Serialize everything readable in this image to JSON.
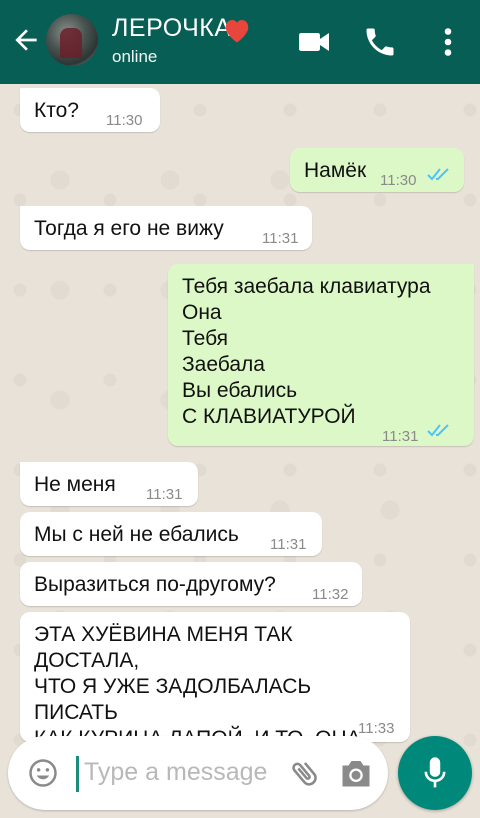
{
  "header": {
    "contact_name": "ЛЕРОЧКА",
    "status": "online",
    "accent_color": "#075e54",
    "icons": [
      "back-arrow-icon",
      "heart-icon",
      "video-call-icon",
      "phone-icon",
      "more-vert-icon"
    ]
  },
  "messages": [
    {
      "direction": "in",
      "text": "Кто?",
      "time": "11:30"
    },
    {
      "direction": "out",
      "text": "Намёк",
      "time": "11:30",
      "read": true
    },
    {
      "direction": "in",
      "text": "Тогда я его не вижу",
      "time": "11:31"
    },
    {
      "direction": "out",
      "text": "Тебя заебала клавиатура\nОна\nТебя\nЗаебала\nВы ебались\nС КЛАВИАТУРОЙ",
      "time": "11:31",
      "read": true
    },
    {
      "direction": "in",
      "text": "Не меня",
      "time": "11:31"
    },
    {
      "direction": "in",
      "text": "Мы с ней не ебались",
      "time": "11:31"
    },
    {
      "direction": "in",
      "text": "Выразиться по-другому?",
      "time": "11:32"
    },
    {
      "direction": "in",
      "text": "ЭТА ХУЁВИНА МЕНЯ ТАК ДОСТАЛА,\nЧТО Я УЖЕ ЗАДОЛБАЛАСЬ ПИСАТЬ\nКАК КУРИЦА ЛАПОЙ, И ТО, ОНА\nЛУЧШЕ МЕНЯ ПИШЕТ",
      "time": "11:33"
    }
  ],
  "composer": {
    "placeholder": "Type a message",
    "icons": [
      "emoji-icon",
      "attach-icon",
      "camera-icon",
      "mic-icon"
    ],
    "mic_color": "#00897b"
  },
  "colors": {
    "incoming_bubble": "#ffffff",
    "outgoing_bubble": "#dcf8c6",
    "read_ticks": "#4fc3f7"
  }
}
